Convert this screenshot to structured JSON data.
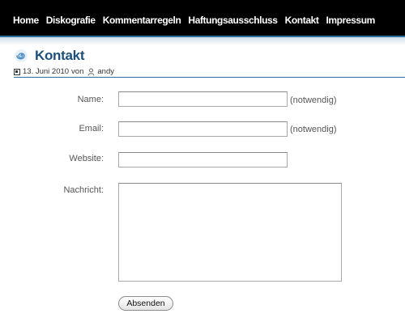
{
  "nav": {
    "items": [
      "Home",
      "Diskografie",
      "Kommentarregeln",
      "Haftungsausschluss",
      "Kontakt",
      "Impressum"
    ]
  },
  "page": {
    "title": "Kontakt",
    "title_icon": "spiral-icon",
    "date": "13. Juni 2010",
    "by": "von",
    "author": "andy"
  },
  "form": {
    "name_label": "Name:",
    "email_label": "Email:",
    "website_label": "Website:",
    "message_label": "Nachricht:",
    "required_hint": "(notwendig)",
    "name_value": "",
    "email_value": "",
    "website_value": "",
    "message_value": "",
    "submit_label": "Absenden"
  },
  "colors": {
    "accent": "#1d4f7c",
    "navbar": "#000000",
    "rule": "#2b6e9e"
  }
}
